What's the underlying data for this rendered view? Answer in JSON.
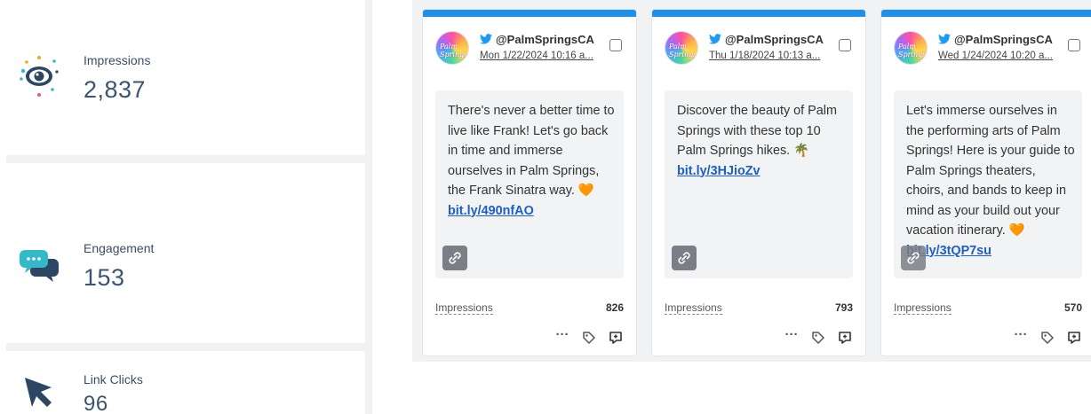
{
  "metrics": [
    {
      "label": "Impressions",
      "value": "2,837",
      "icon": "eye-icon"
    },
    {
      "label": "Engagement",
      "value": "153",
      "icon": "chat-bubbles-icon"
    },
    {
      "label": "Link Clicks",
      "value": "96",
      "icon": "cursor-arrow-icon"
    }
  ],
  "cards": [
    {
      "handle": "@PalmSpringsCA",
      "date": "Mon 1/22/2024 10:16 a...",
      "avatar_text": "Palm Springs",
      "text": "There's never a better time to live like Frank! Let's go back in time and immerse ourselves in Palm Springs, the Frank Sinatra way. 🧡",
      "link": "bit.ly/490nfAO",
      "impressions_label": "Impressions",
      "impressions": "826"
    },
    {
      "handle": "@PalmSpringsCA",
      "date": "Thu 1/18/2024 10:13 a...",
      "avatar_text": "Palm Springs",
      "text": "Discover the beauty of Palm Springs with these top 10 Palm Springs hikes. 🌴",
      "link": "bit.ly/3HJioZv",
      "impressions_label": "Impressions",
      "impressions": "793"
    },
    {
      "handle": "@PalmSpringsCA",
      "date": "Wed 1/24/2024 10:20 a...",
      "avatar_text": "Palm Springs",
      "text": "Let's immerse ourselves in the performing arts of Palm Springs! Here is your guide to Palm Springs theaters, choirs, and bands to keep in mind as your build out your vacation itinerary. 🧡",
      "link": "bit.ly/3tQP7su",
      "impressions_label": "Impressions",
      "impressions": "570"
    }
  ],
  "colors": {
    "accent_bar": "#1e90e8",
    "link": "#1f5fbf",
    "metric_value": "#3d5470",
    "panel_bg": "#f1f2f4"
  }
}
